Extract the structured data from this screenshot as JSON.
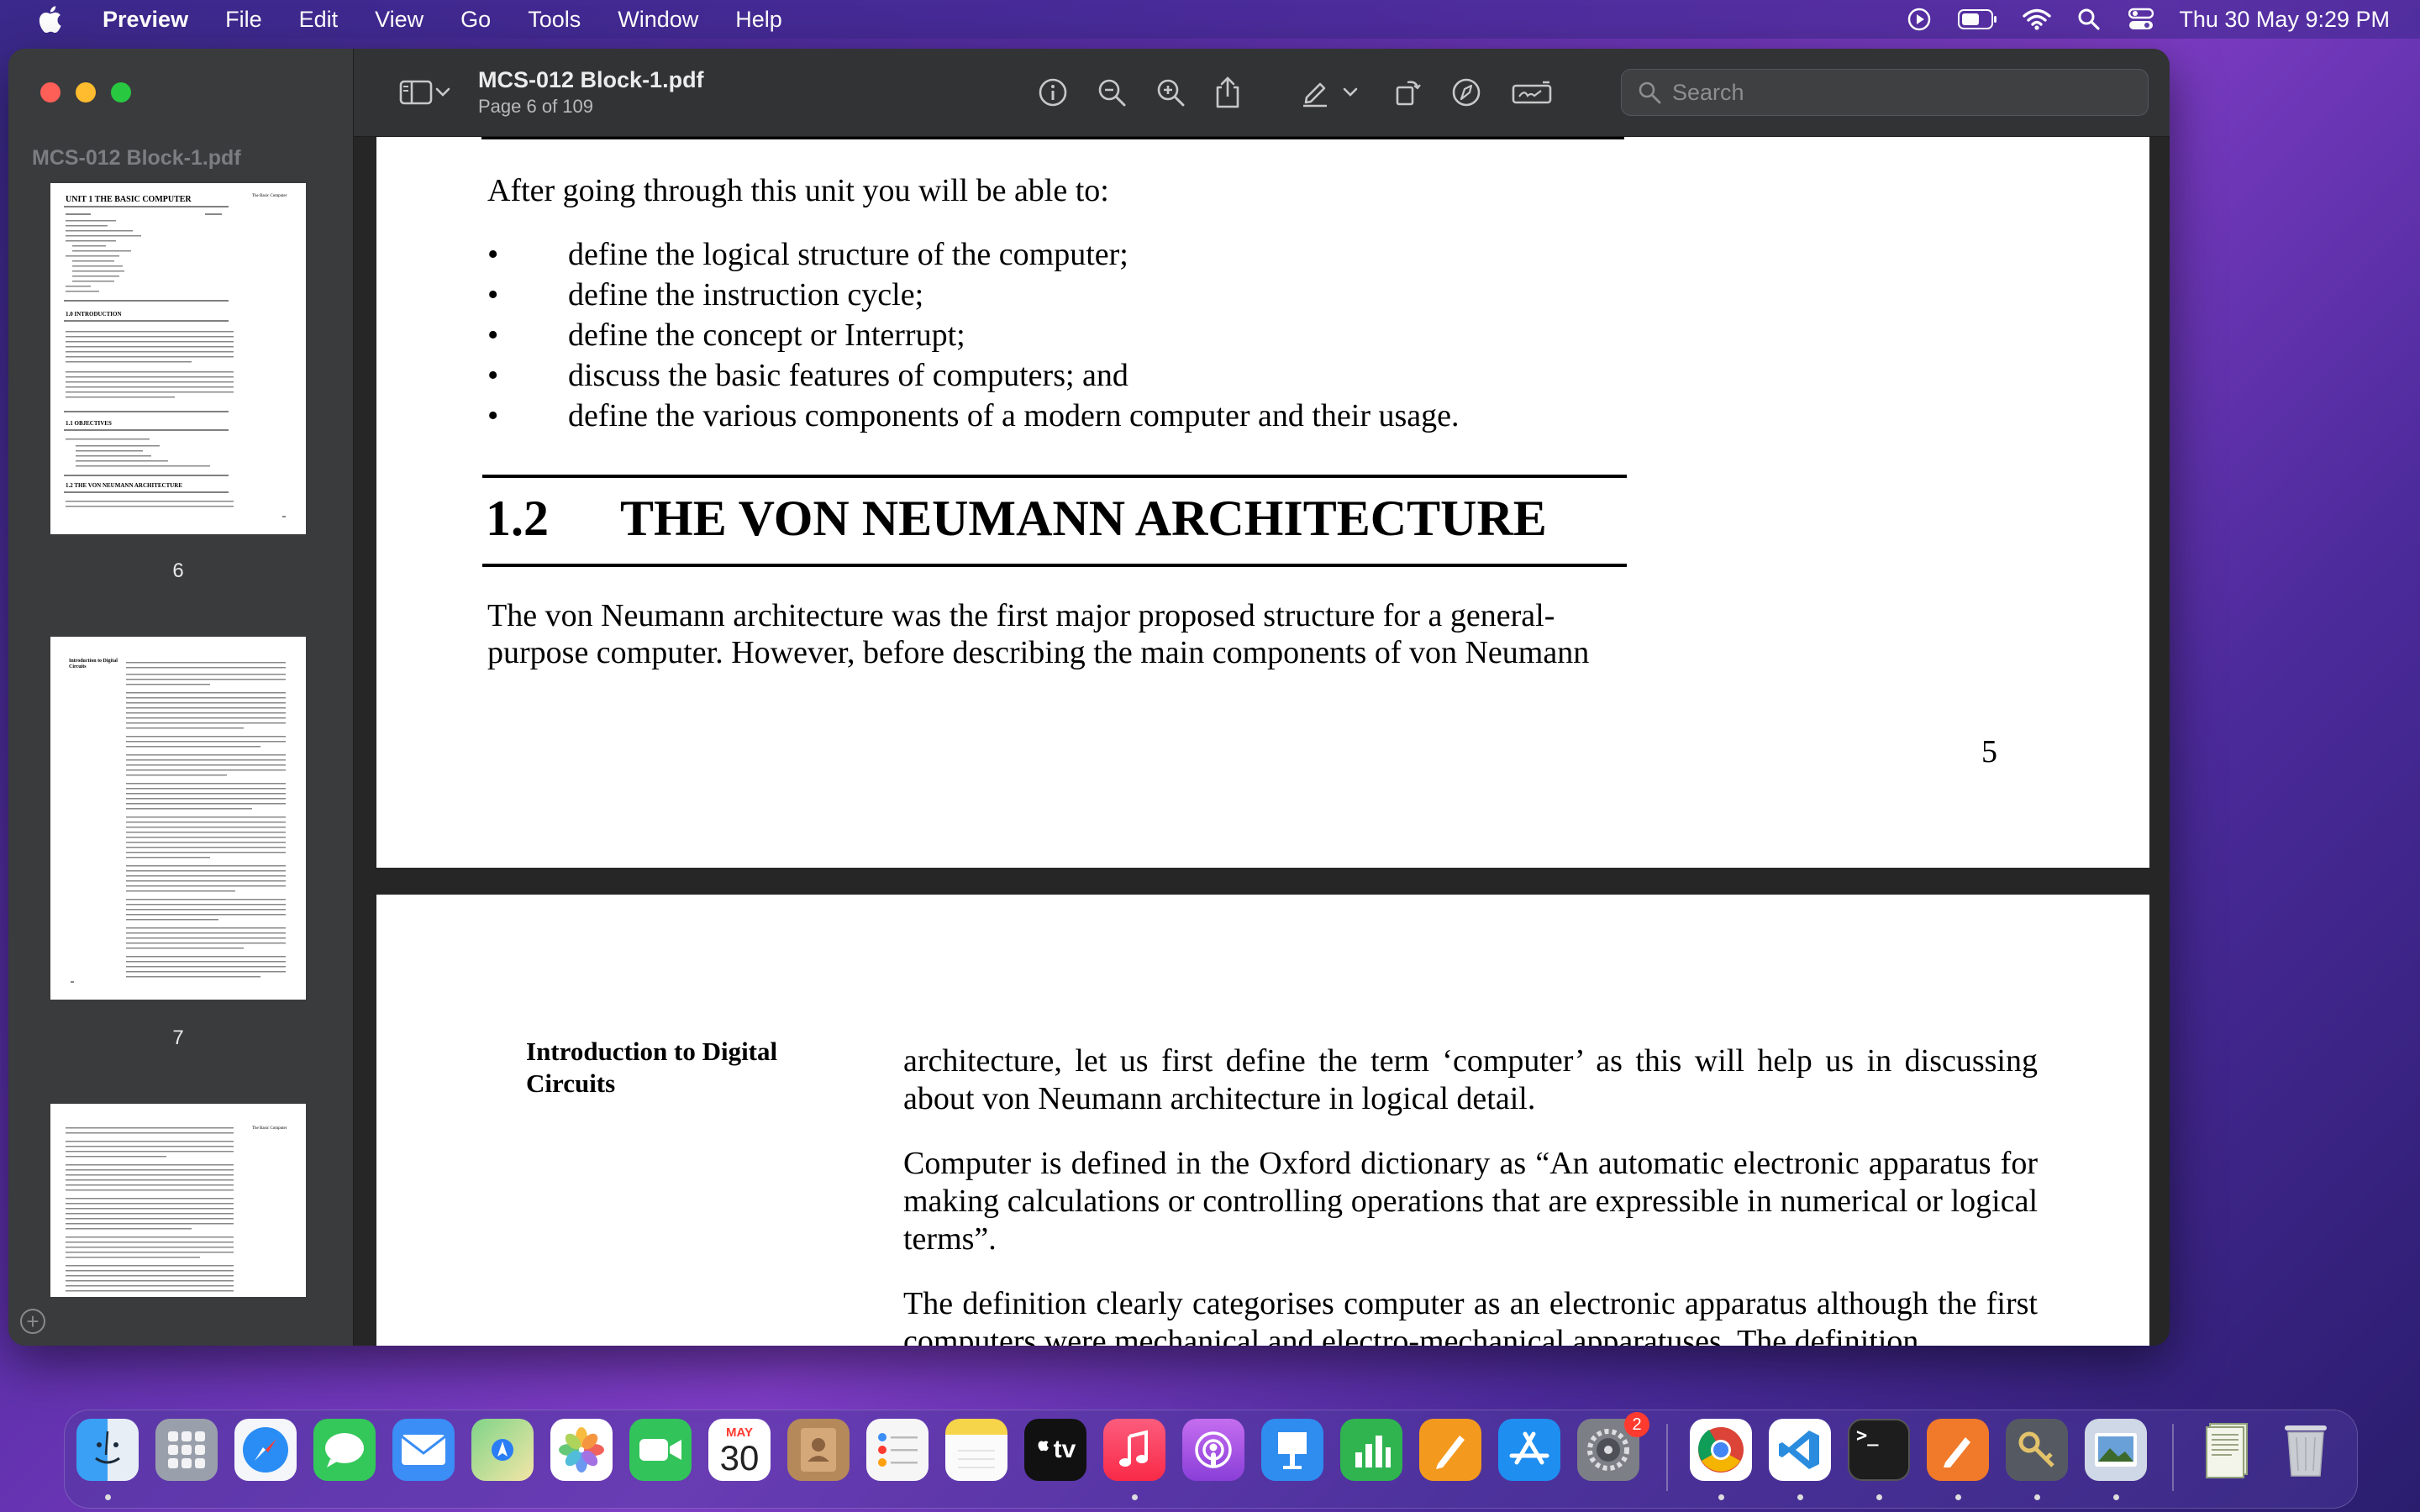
{
  "menubar": {
    "apple": "",
    "app_name": "Preview",
    "items": [
      "File",
      "Edit",
      "View",
      "Go",
      "Tools",
      "Window",
      "Help"
    ],
    "clock": "Thu 30 May  9:29 PM",
    "status_icons": [
      "play-circle-icon",
      "battery-icon",
      "wifi-icon",
      "search-icon",
      "control-center-icon"
    ]
  },
  "window": {
    "sidebar": {
      "title": "MCS-012 Block-1.pdf",
      "thumbnails": [
        {
          "page_label": "6",
          "heading": "UNIT 1   THE BASIC COMPUTER"
        },
        {
          "page_label": "7",
          "heading": "Introduction to Digital Circuits"
        },
        {
          "page_label": "",
          "heading": "The Basic Computer"
        }
      ]
    },
    "toolbar": {
      "doc_title": "MCS-012 Block-1.pdf",
      "page_info": "Page 6 of 109",
      "search_placeholder": "Search",
      "icons": [
        "sidebar-toggle-icon",
        "chevron-down-icon",
        "info-icon",
        "zoom-out-icon",
        "zoom-in-icon",
        "share-icon",
        "highlight-pen-icon",
        "chevron-down-icon",
        "rotate-icon",
        "markup-icon",
        "sign-icon",
        "search-icon"
      ]
    },
    "page1": {
      "intro": "After going through this unit you will be able to:",
      "bullets": [
        "define the logical structure of the computer;",
        "define the instruction cycle;",
        "define the concept or Interrupt;",
        "discuss the basic features of computers; and",
        "define the various components of a modern computer and their usage."
      ],
      "bullet_symbol": "•",
      "section_number": "1.2",
      "section_title": "THE VON NEUMANN ARCHITECTURE",
      "paragraph": "The von Neumann architecture was the first major proposed structure for a general-purpose computer. However, before describing the main components of von Neumann",
      "page_number": "5"
    },
    "page2": {
      "side_heading": "Introduction to Digital Circuits",
      "paragraphs": [
        "architecture, let us first define the term ‘computer’ as this will help us in discussing about von Neumann architecture in logical detail.",
        "Computer is defined in the Oxford dictionary as “An automatic electronic apparatus for making calculations or controlling operations that are expressible in numerical or logical terms”.",
        "The definition clearly categorises computer as an electronic apparatus although the first computers were mechanical and electro-mechanical apparatuses. The definition"
      ]
    }
  },
  "dock": {
    "apps": [
      {
        "name": "Finder",
        "icon": "finder-icon",
        "color": "#2a8cf0"
      },
      {
        "name": "Launchpad",
        "icon": "launchpad-icon",
        "color": "#8a8f9a"
      },
      {
        "name": "Safari",
        "icon": "safari-icon",
        "color": "#2a8df5"
      },
      {
        "name": "Messages",
        "icon": "messages-icon",
        "color": "#34c759"
      },
      {
        "name": "Mail",
        "icon": "mail-icon",
        "color": "#3b8ef5"
      },
      {
        "name": "Maps",
        "icon": "maps-icon",
        "color": "#4cc26e"
      },
      {
        "name": "Photos",
        "icon": "photos-icon",
        "color": "#f5a623"
      },
      {
        "name": "FaceTime",
        "icon": "facetime-icon",
        "color": "#32c45a"
      },
      {
        "name": "Calendar",
        "icon": "calendar-icon",
        "color": "#ffffff",
        "month": "MAY",
        "day": "30"
      },
      {
        "name": "Contacts",
        "icon": "contacts-icon",
        "color": "#b5895a"
      },
      {
        "name": "Reminders",
        "icon": "reminders-icon",
        "color": "#f2f2f2"
      },
      {
        "name": "Notes",
        "icon": "notes-icon",
        "color": "#f7d54a"
      },
      {
        "name": "TV",
        "icon": "tv-icon",
        "color": "#111111",
        "label": "tv"
      },
      {
        "name": "Music",
        "icon": "music-icon",
        "color": "#fa3c50"
      },
      {
        "name": "Podcasts",
        "icon": "podcasts-icon",
        "color": "#9b4ee0"
      },
      {
        "name": "Keynote",
        "icon": "keynote-icon",
        "color": "#2f8df0"
      },
      {
        "name": "Numbers",
        "icon": "numbers-icon",
        "color": "#2fb44f"
      },
      {
        "name": "Pages",
        "icon": "pages-icon",
        "color": "#f39a1e"
      },
      {
        "name": "App Store",
        "icon": "app-store-icon",
        "color": "#1e8ef0"
      },
      {
        "name": "System Settings",
        "icon": "system-settings-icon",
        "color": "#7c7f86",
        "badge": "2"
      },
      {
        "name": "Chrome",
        "icon": "chrome-icon",
        "color": "#ffffff"
      },
      {
        "name": "VS Code",
        "icon": "vscode-icon",
        "color": "#ffffff"
      },
      {
        "name": "Terminal",
        "icon": "terminal-icon",
        "color": "#1d1d1d",
        "label": ">_"
      },
      {
        "name": "Pen App",
        "icon": "pen-app-icon",
        "color": "#f07a2a"
      },
      {
        "name": "Keychain",
        "icon": "keychain-icon",
        "color": "#555a62"
      },
      {
        "name": "Preview",
        "icon": "preview-icon",
        "color": "#cfd8e6"
      },
      {
        "name": "Downloads",
        "icon": "downloads-stack-icon",
        "color": "#8fa07a"
      },
      {
        "name": "Trash",
        "icon": "trash-icon",
        "color": "#c9ccd2"
      }
    ]
  }
}
